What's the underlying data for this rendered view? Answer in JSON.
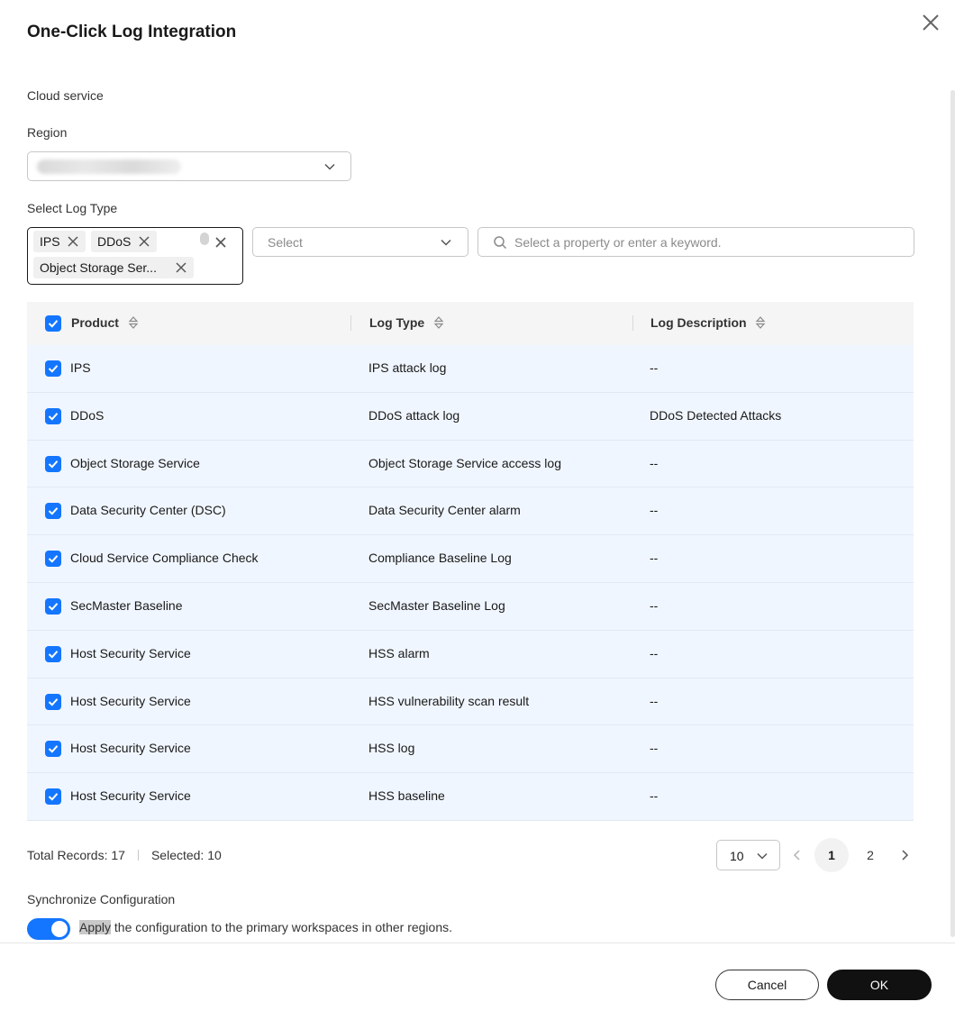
{
  "dialog": {
    "title": "One-Click Log Integration"
  },
  "form": {
    "cloud_service_label": "Cloud service",
    "region_label": "Region",
    "log_type_label": "Select Log Type",
    "selected_tags": [
      "IPS",
      "DDoS",
      "Object Storage Ser..."
    ],
    "select_placeholder": "Select",
    "search_placeholder": "Select a property or enter a keyword."
  },
  "table": {
    "columns": [
      "Product",
      "Log Type",
      "Log Description"
    ],
    "rows": [
      {
        "product": "IPS",
        "log_type": "IPS attack log",
        "description": "--"
      },
      {
        "product": "DDoS",
        "log_type": "DDoS attack log",
        "description": "DDoS Detected Attacks"
      },
      {
        "product": "Object Storage Service",
        "log_type": "Object Storage Service access log",
        "description": "--"
      },
      {
        "product": "Data Security Center (DSC)",
        "log_type": "Data Security Center alarm",
        "description": "--"
      },
      {
        "product": "Cloud Service Compliance Check",
        "log_type": "Compliance Baseline Log",
        "description": "--"
      },
      {
        "product": "SecMaster Baseline",
        "log_type": "SecMaster Baseline Log",
        "description": "--"
      },
      {
        "product": "Host Security Service",
        "log_type": "HSS alarm",
        "description": "--"
      },
      {
        "product": "Host Security Service",
        "log_type": "HSS vulnerability scan result",
        "description": "--"
      },
      {
        "product": "Host Security Service",
        "log_type": "HSS log",
        "description": "--"
      },
      {
        "product": "Host Security Service",
        "log_type": "HSS baseline",
        "description": "--"
      }
    ]
  },
  "footer": {
    "total": "Total Records: 17",
    "selected": "Selected: 10",
    "page_size": "10",
    "pages": [
      "1",
      "2"
    ]
  },
  "sync": {
    "label": "Synchronize Configuration",
    "text_highlight": "Apply",
    "text_rest": " the configuration to the primary workspaces in other regions.",
    "enabled": true
  },
  "actions": {
    "cancel": "Cancel",
    "ok": "OK"
  },
  "colors": {
    "primary": "#1476ff",
    "row_bg": "#f0f6ff",
    "ok_bg": "#111111"
  }
}
